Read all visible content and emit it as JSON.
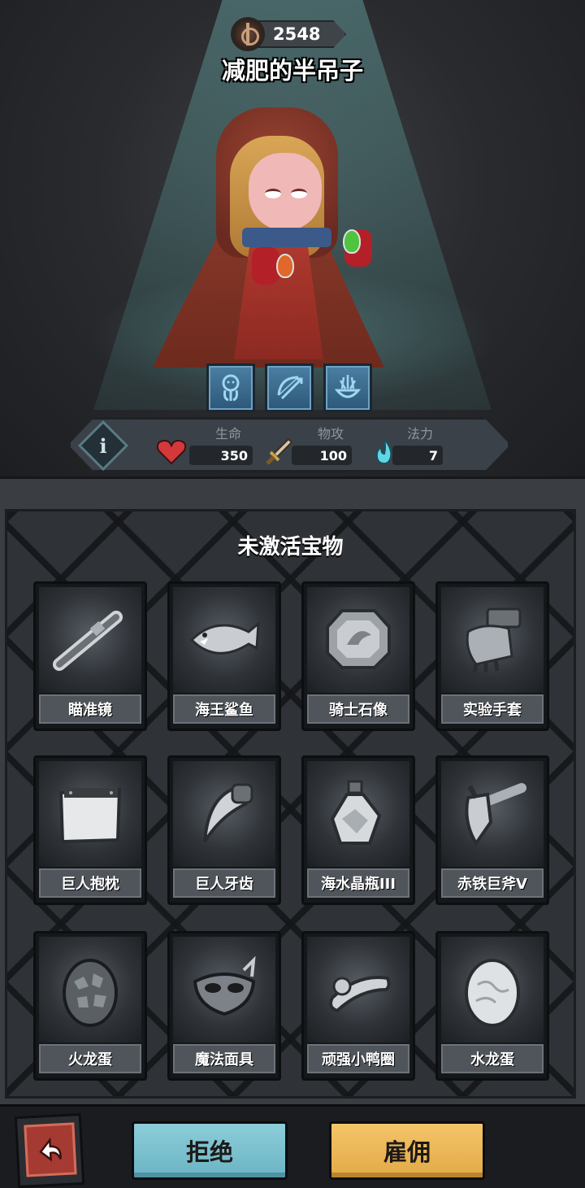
{
  "hero": {
    "score": "2548",
    "name": "减肥的半吊子"
  },
  "skills": [
    {
      "icon": "ghost-spirit-icon"
    },
    {
      "icon": "bow-arrow-icon"
    },
    {
      "icon": "flame-bowl-icon"
    }
  ],
  "stats": {
    "hp": {
      "label": "生命",
      "value": "350",
      "icon": "heart-icon"
    },
    "attack": {
      "label": "物攻",
      "value": "100",
      "icon": "sword-icon"
    },
    "magic": {
      "label": "法力",
      "value": "7",
      "icon": "blue-flame-icon"
    }
  },
  "treasures": {
    "title": "未激活宝物",
    "items": [
      {
        "name": "瞄准镜",
        "icon": "scope-icon"
      },
      {
        "name": "海王鲨鱼",
        "icon": "shark-icon"
      },
      {
        "name": "骑士石像",
        "icon": "stone-tablet-icon"
      },
      {
        "name": "实验手套",
        "icon": "gauntlet-icon"
      },
      {
        "name": "巨人抱枕",
        "icon": "pillow-icon"
      },
      {
        "name": "巨人牙齿",
        "icon": "fang-icon"
      },
      {
        "name": "海水晶瓶III",
        "icon": "crystal-bottle-icon"
      },
      {
        "name": "赤铁巨斧V",
        "icon": "axe-icon"
      },
      {
        "name": "火龙蛋",
        "icon": "fire-egg-icon"
      },
      {
        "name": "魔法面具",
        "icon": "mask-icon"
      },
      {
        "name": "顽强小鸭圈",
        "icon": "duck-ring-icon"
      },
      {
        "name": "水龙蛋",
        "icon": "water-egg-icon"
      }
    ]
  },
  "actions": {
    "back_icon": "return-arrow-icon",
    "reject": "拒绝",
    "hire": "雇佣"
  }
}
